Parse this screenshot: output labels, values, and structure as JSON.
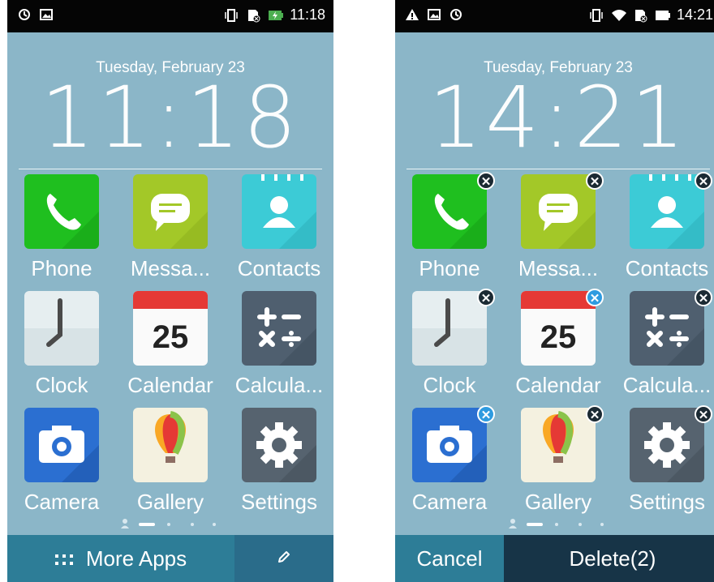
{
  "left": {
    "status_time": "11:18",
    "date": "Tuesday, February 23",
    "clock": "11:18",
    "more_apps_label": "More Apps"
  },
  "right": {
    "status_time": "14:21",
    "date": "Tuesday, February 23",
    "clock": "14:21",
    "cancel_label": "Cancel",
    "delete_label": "Delete(2)"
  },
  "apps": [
    {
      "label": "Phone",
      "icon": "phone-icon"
    },
    {
      "label": "Messa...",
      "icon": "messages-icon"
    },
    {
      "label": "Contacts",
      "icon": "contacts-icon"
    },
    {
      "label": "Clock",
      "icon": "clock-icon"
    },
    {
      "label": "Calendar",
      "icon": "calendar-icon",
      "day": "25"
    },
    {
      "label": "Calcula...",
      "icon": "calculator-icon"
    },
    {
      "label": "Camera",
      "icon": "camera-icon"
    },
    {
      "label": "Gallery",
      "icon": "gallery-icon"
    },
    {
      "label": "Settings",
      "icon": "settings-icon"
    }
  ],
  "colors": {
    "wallpaper": "#8bb6c8",
    "bottom_bar": "#2d7d97",
    "delete_bar": "#173447",
    "remove_badge": "#1b2a33",
    "selected_badge": "#2e9be0"
  }
}
